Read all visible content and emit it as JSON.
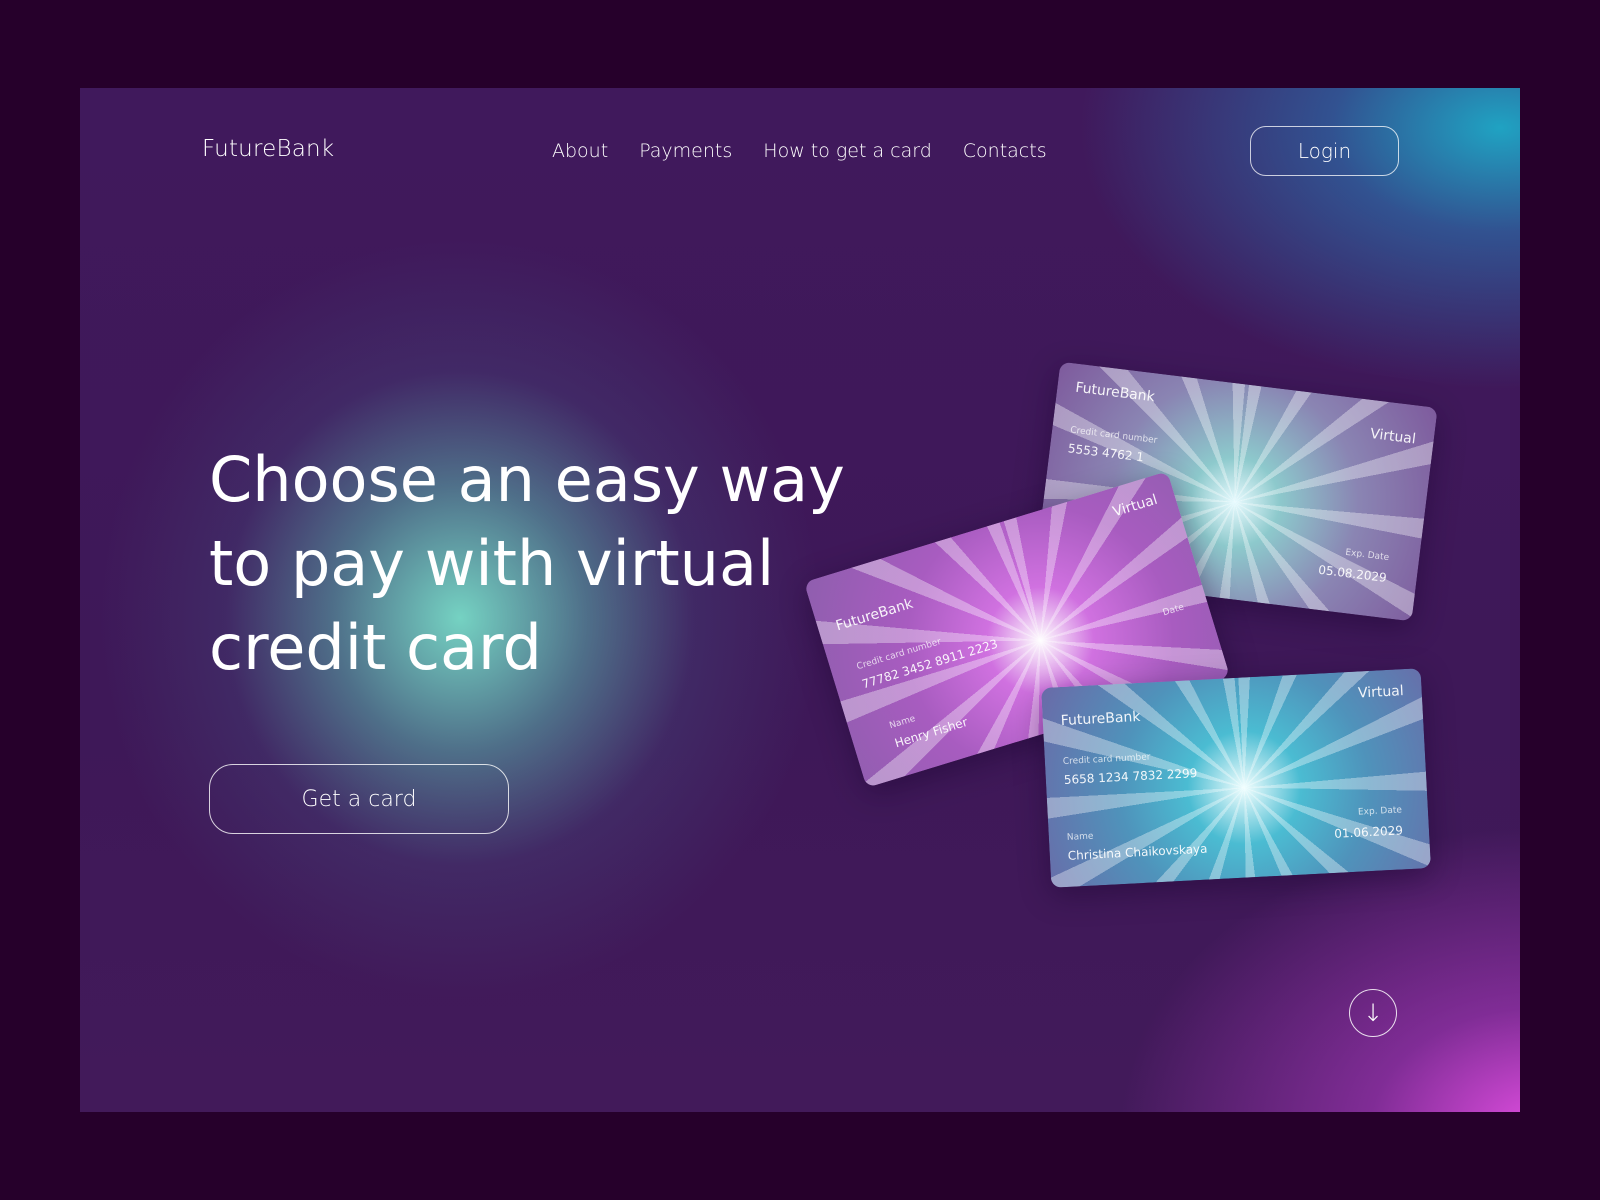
{
  "header": {
    "logo": "FutureBank",
    "nav": [
      "About",
      "Payments",
      "How to get a card",
      "Contacts"
    ],
    "login_label": "Login"
  },
  "hero": {
    "headline_lines": [
      "Choose an easy way",
      "to pay with virtual",
      "credit card"
    ],
    "cta_label": "Get a card",
    "scroll_icon": "arrow-down-icon"
  },
  "cards": [
    {
      "brand": "FutureBank",
      "type": "Virtual",
      "number_label": "Credit card number",
      "number": "5553 4762 1",
      "exp_label": "Exp. Date",
      "exp": "05.08.2029"
    },
    {
      "brand": "FutureBank",
      "type": "Virtual",
      "number_label": "Credit card number",
      "number": "77782 3452 8911 2223",
      "name_label": "Name",
      "name": "Henry Fisher",
      "exp_label": "Date"
    },
    {
      "brand": "FutureBank",
      "type": "Virtual",
      "number_label": "Credit card number",
      "number": "5658 1234 7832 2299",
      "name_label": "Name",
      "name": "Christina Chaikovskaya",
      "exp_label": "Exp. Date",
      "exp": "01.06.2029"
    }
  ],
  "colors": {
    "outer_bg": "#26002b",
    "frame_bg": "#40195c",
    "teal_glow": "#78dcc8",
    "blue_glow": "#1eaac8",
    "pink_glow": "#e650e6"
  }
}
